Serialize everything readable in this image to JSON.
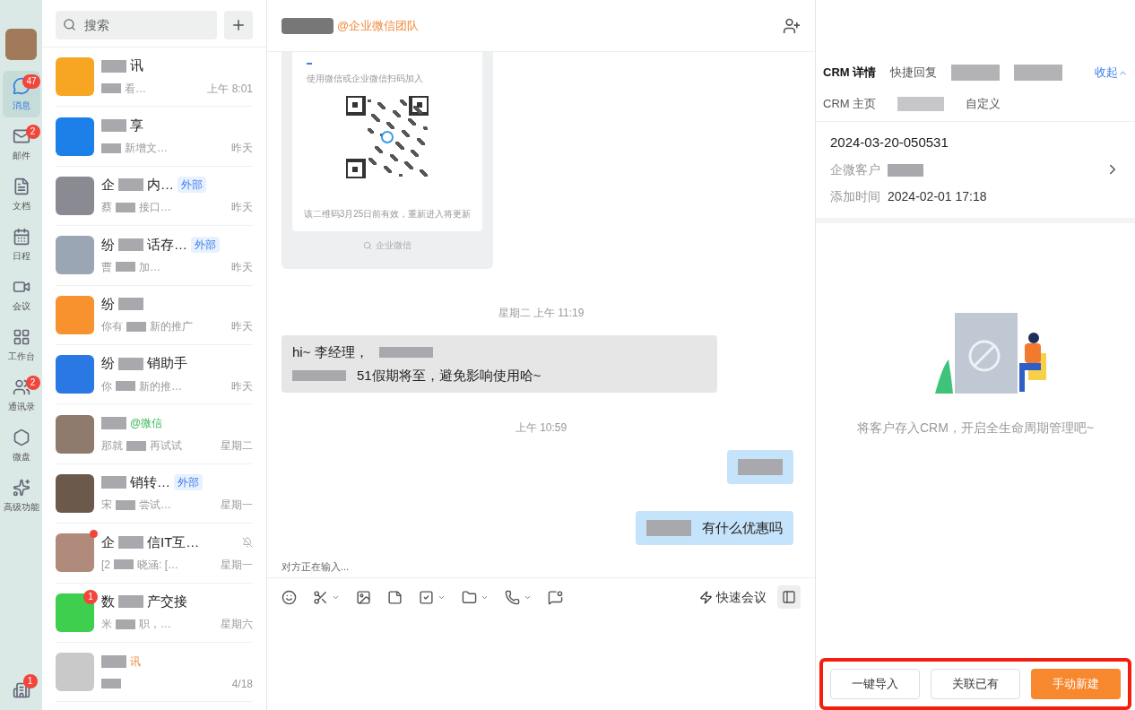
{
  "nav": {
    "items": [
      {
        "label": "消息",
        "badge": "47",
        "selected": true
      },
      {
        "label": "邮件",
        "badge": "2",
        "selected": false
      },
      {
        "label": "文档",
        "selected": false
      },
      {
        "label": "日程",
        "selected": false
      },
      {
        "label": "会议",
        "selected": false
      },
      {
        "label": "工作台",
        "selected": false
      },
      {
        "label": "通讯录",
        "badge": "2",
        "selected": false
      },
      {
        "label": "微盘",
        "selected": false
      },
      {
        "label": "高级功能",
        "selected": false
      }
    ],
    "bottom_badge": "1"
  },
  "search": {
    "placeholder": "搜索"
  },
  "chats": [
    {
      "name": [
        {
          "kind": "redacted"
        },
        "讯"
      ],
      "preview": [
        {
          "kind": "redacted"
        },
        "看…"
      ],
      "time": "上午 8:01",
      "unread_dot": false
    },
    {
      "name": [
        {
          "kind": "redacted"
        },
        "享"
      ],
      "preview": [
        {
          "kind": "redacted"
        },
        "新增文…"
      ],
      "time": "昨天",
      "unread_dot": false
    },
    {
      "name": [
        "企",
        {
          "kind": "redacted"
        },
        "内…"
      ],
      "tag": {
        "text": "外部",
        "kind": "external"
      },
      "preview": [
        "蔡",
        {
          "kind": "redacted"
        },
        "接口…"
      ],
      "time": "昨天",
      "unread_dot": false
    },
    {
      "name": [
        "纷",
        {
          "kind": "redacted"
        },
        "话存…"
      ],
      "tag": {
        "text": "外部",
        "kind": "external"
      },
      "preview": [
        "曹",
        {
          "kind": "redacted"
        },
        "加…"
      ],
      "time": "昨天",
      "unread_dot": false
    },
    {
      "name": [
        "纷",
        {
          "kind": "redacted"
        }
      ],
      "preview": [
        "你有",
        {
          "kind": "redacted"
        },
        "新的推广"
      ],
      "time": "昨天",
      "unread_dot": false
    },
    {
      "name": [
        "纷",
        {
          "kind": "redacted"
        },
        "销助手"
      ],
      "preview": [
        "你",
        {
          "kind": "redacted"
        },
        "新的推…"
      ],
      "time": "昨天",
      "unread_dot": false
    },
    {
      "name": [
        {
          "kind": "redacted"
        }
      ],
      "tag": {
        "text": "@微信",
        "kind": "wechat"
      },
      "preview": [
        "那就",
        {
          "kind": "redacted"
        },
        "再试试"
      ],
      "time": "星期二",
      "unread_dot": false
    },
    {
      "name": [
        {
          "kind": "redacted"
        },
        "销转…"
      ],
      "tag": {
        "text": "外部",
        "kind": "external"
      },
      "preview": [
        "宋",
        {
          "kind": "redacted"
        },
        "尝试…"
      ],
      "time": "星期一",
      "unread_dot": false
    },
    {
      "name": [
        "企",
        {
          "kind": "redacted"
        },
        "信IT互…"
      ],
      "muted": true,
      "preview": [
        "[2",
        {
          "kind": "redacted"
        },
        "晓涵: […"
      ],
      "time": "星期一",
      "unread_dot": true
    },
    {
      "name": [
        "数",
        {
          "kind": "redacted"
        },
        "产交接"
      ],
      "badge": "1",
      "preview": [
        "米",
        {
          "kind": "redacted"
        },
        "职，…"
      ],
      "time": "星期六",
      "unread_dot": false
    },
    {
      "name": [
        {
          "kind": "redacted"
        }
      ],
      "tag": {
        "text": "讯",
        "kind": "orange"
      },
      "preview": [
        {
          "kind": "redacted"
        }
      ],
      "time": "4/18",
      "unread_dot": false
    }
  ],
  "chat": {
    "title_suffix": "@企业微信团队",
    "qr_card": {
      "hint": "使用微信或企业微信扫码加入",
      "validity": "该二维码3月25日前有效，重新进入将更新",
      "brand": "企业微信"
    },
    "messages": [
      {
        "kind": "time",
        "text": "星期二 上午 11:19"
      },
      {
        "kind": "incoming",
        "lines": [
          [
            "hi~ 李经理，",
            {
              "kind": "redacted"
            }
          ],
          [
            {
              "kind": "redacted"
            },
            "51假期将至，避免影响使用哈~"
          ]
        ]
      },
      {
        "kind": "time",
        "text": "上午 10:59"
      },
      {
        "kind": "outgoing",
        "lines": [
          [
            {
              "kind": "redacted"
            }
          ]
        ]
      },
      {
        "kind": "outgoing",
        "lines": [
          [
            {
              "kind": "redacted"
            },
            "有什么优惠吗"
          ]
        ]
      }
    ],
    "typing": "对方正在输入...",
    "quick_meeting": "快速会议"
  },
  "crm": {
    "tabs": [
      {
        "label": "CRM 详情",
        "selected": true
      },
      {
        "label": "快捷回复",
        "selected": false
      },
      {
        "kind": "redacted",
        "selected": false
      },
      {
        "kind": "redacted",
        "selected": false
      }
    ],
    "collapse": "收起",
    "subtabs": [
      {
        "label": "CRM 主页"
      },
      {
        "kind": "redacted"
      },
      {
        "label": "自定义"
      }
    ],
    "record": {
      "id": "2024-03-20-050531",
      "fields": [
        {
          "label": "企微客户",
          "value": [
            {
              "kind": "redacted"
            }
          ]
        },
        {
          "label": "添加时间",
          "value": [
            "2024-02-01 17:18"
          ]
        }
      ]
    },
    "empty_text": "将客户存入CRM，开启全生命周期管理吧~",
    "buttons": [
      {
        "label": "一键导入",
        "primary": false
      },
      {
        "label": "关联已有",
        "primary": false
      },
      {
        "label": "手动新建",
        "primary": true
      }
    ],
    "highlighted": true
  }
}
